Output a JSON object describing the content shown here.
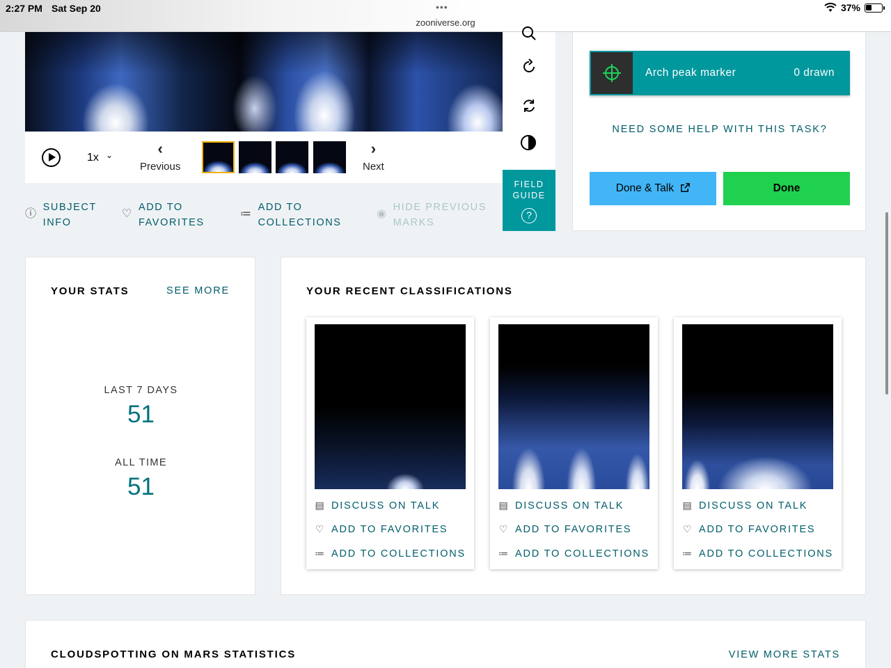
{
  "status_bar": {
    "time": "2:27 PM",
    "date": "Sat Sep 20",
    "dots": "•••",
    "url": "zooniverse.org",
    "battery": "37%"
  },
  "viewer": {
    "speed": "1x",
    "previous_label": "Previous",
    "next_label": "Next",
    "frame_count": 4,
    "selected_frame": 0
  },
  "toolbar": {
    "field_guide_label": "FIELD GUIDE",
    "field_guide_icon": "?"
  },
  "meta_links": {
    "subject_info": "SUBJECT INFO",
    "add_favorites": "ADD TO FAVORITES",
    "add_collections": "ADD TO COLLECTIONS",
    "hide_marks": "HIDE PREVIOUS MARKS"
  },
  "task": {
    "tool_name": "Arch peak marker",
    "tool_count": "0 drawn",
    "help_link": "NEED SOME HELP WITH THIS TASK?",
    "done_talk_label": "Done & Talk",
    "done_label": "Done"
  },
  "stats": {
    "title": "YOUR STATS",
    "see_more": "SEE MORE",
    "last7_label": "LAST 7 DAYS",
    "last7_value": "51",
    "alltime_label": "ALL TIME",
    "alltime_value": "51"
  },
  "recents": {
    "title": "YOUR RECENT CLASSIFICATIONS",
    "items": [
      {
        "talk": "DISCUSS ON TALK",
        "favorites": "ADD TO FAVORITES",
        "collections": "ADD TO COLLECTIONS"
      },
      {
        "talk": "DISCUSS ON TALK",
        "favorites": "ADD TO FAVORITES",
        "collections": "ADD TO COLLECTIONS"
      },
      {
        "talk": "DISCUSS ON TALK",
        "favorites": "ADD TO FAVORITES",
        "collections": "ADD TO COLLECTIONS"
      }
    ]
  },
  "project_stats": {
    "title": "CLOUDSPOTTING ON MARS STATISTICS",
    "view_more": "VIEW MORE STATS"
  },
  "colors": {
    "teal": "#00979d",
    "link": "#005d69",
    "done": "#20d14f",
    "done_talk": "#42b5f6",
    "selected_frame": "#f0b200"
  }
}
